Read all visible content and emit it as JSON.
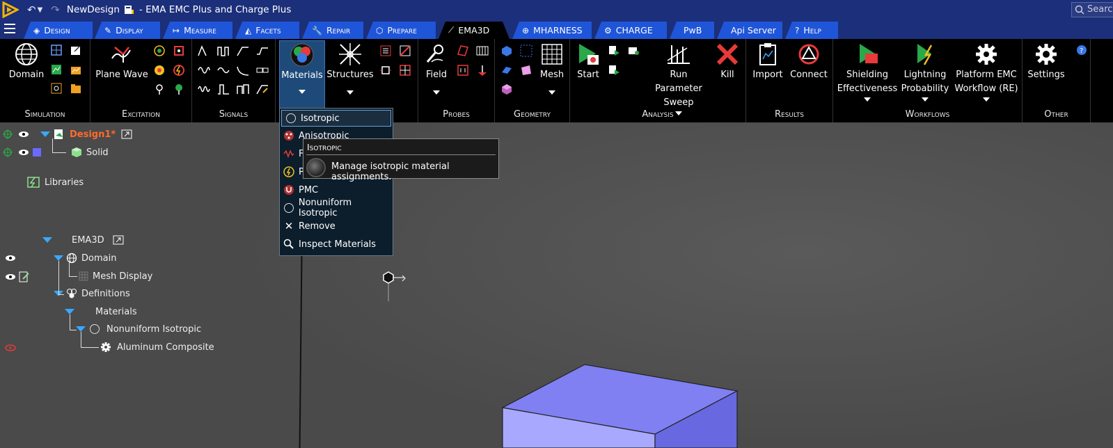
{
  "titlebar": {
    "doc_name": "NewDesign",
    "app_title": "- EMA EMC Plus and Charge Plus",
    "search_placeholder": "Search"
  },
  "tabs": [
    {
      "label": "Design",
      "icon": "design-icon"
    },
    {
      "label": "Display",
      "icon": "brush-icon"
    },
    {
      "label": "Measure",
      "icon": "measure-icon"
    },
    {
      "label": "Facets",
      "icon": "facets-icon"
    },
    {
      "label": "Repair",
      "icon": "wrench-icon"
    },
    {
      "label": "Prepare",
      "icon": "prepare-icon"
    },
    {
      "label": "EMA3D",
      "icon": "ema3d-icon",
      "active": true
    },
    {
      "label": "MHARNESS",
      "icon": "globe-icon"
    },
    {
      "label": "CHARGE",
      "icon": "charge-icon"
    },
    {
      "label": "PwB",
      "icon": ""
    },
    {
      "label": "Api Server",
      "icon": ""
    },
    {
      "label": "Help",
      "icon": "help-icon"
    }
  ],
  "ribbon": {
    "simulation": {
      "label": "Simulation",
      "domain": "Domain"
    },
    "excitation": {
      "label": "Excitation",
      "plane_wave": "Plane Wave"
    },
    "signals": {
      "label": "Signals"
    },
    "materials": {
      "materials": "Materials",
      "structures": "Structures"
    },
    "probes": {
      "label": "Probes",
      "field": "Field"
    },
    "geometry": {
      "label": "Geometry",
      "mesh": "Mesh"
    },
    "analysis": {
      "label": "Analysis",
      "start": "Start",
      "run_sweep_1": "Run Parameter",
      "run_sweep_2": "Sweep",
      "kill": "Kill"
    },
    "results": {
      "label": "Results",
      "import": "Import",
      "connect": "Connect"
    },
    "workflows": {
      "label": "Workflows",
      "shield_1": "Shielding",
      "shield_2": "Effectiveness",
      "light_1": "Lightning",
      "light_2": "Probability",
      "plat_1": "Platform EMC",
      "plat_2": "Workflow (RE)"
    },
    "other": {
      "label": "Other",
      "settings": "Settings"
    }
  },
  "tree": {
    "design": "Design1*",
    "solid": "Solid",
    "libraries": "Libraries",
    "ema3d": "EMA3D",
    "domain": "Domain",
    "mesh_display": "Mesh Display",
    "definitions": "Definitions",
    "materials": "Materials",
    "nonuniform": "Nonuniform Isotropic",
    "aluminum": "Aluminum Composite"
  },
  "dropdown": {
    "items": [
      "Isotropic",
      "Anisotropic",
      "F",
      "P",
      "PMC",
      "Nonuniform Isotropic",
      "Remove",
      "Inspect Materials"
    ]
  },
  "tooltip": {
    "title": "Isotropic",
    "text": "Manage isotropic material assignments."
  },
  "colors": {
    "titlebar": "#1c2f7a",
    "tab": "#1f55d8",
    "accent_orange": "#ff6b2b",
    "box_face": "#8080f0"
  }
}
